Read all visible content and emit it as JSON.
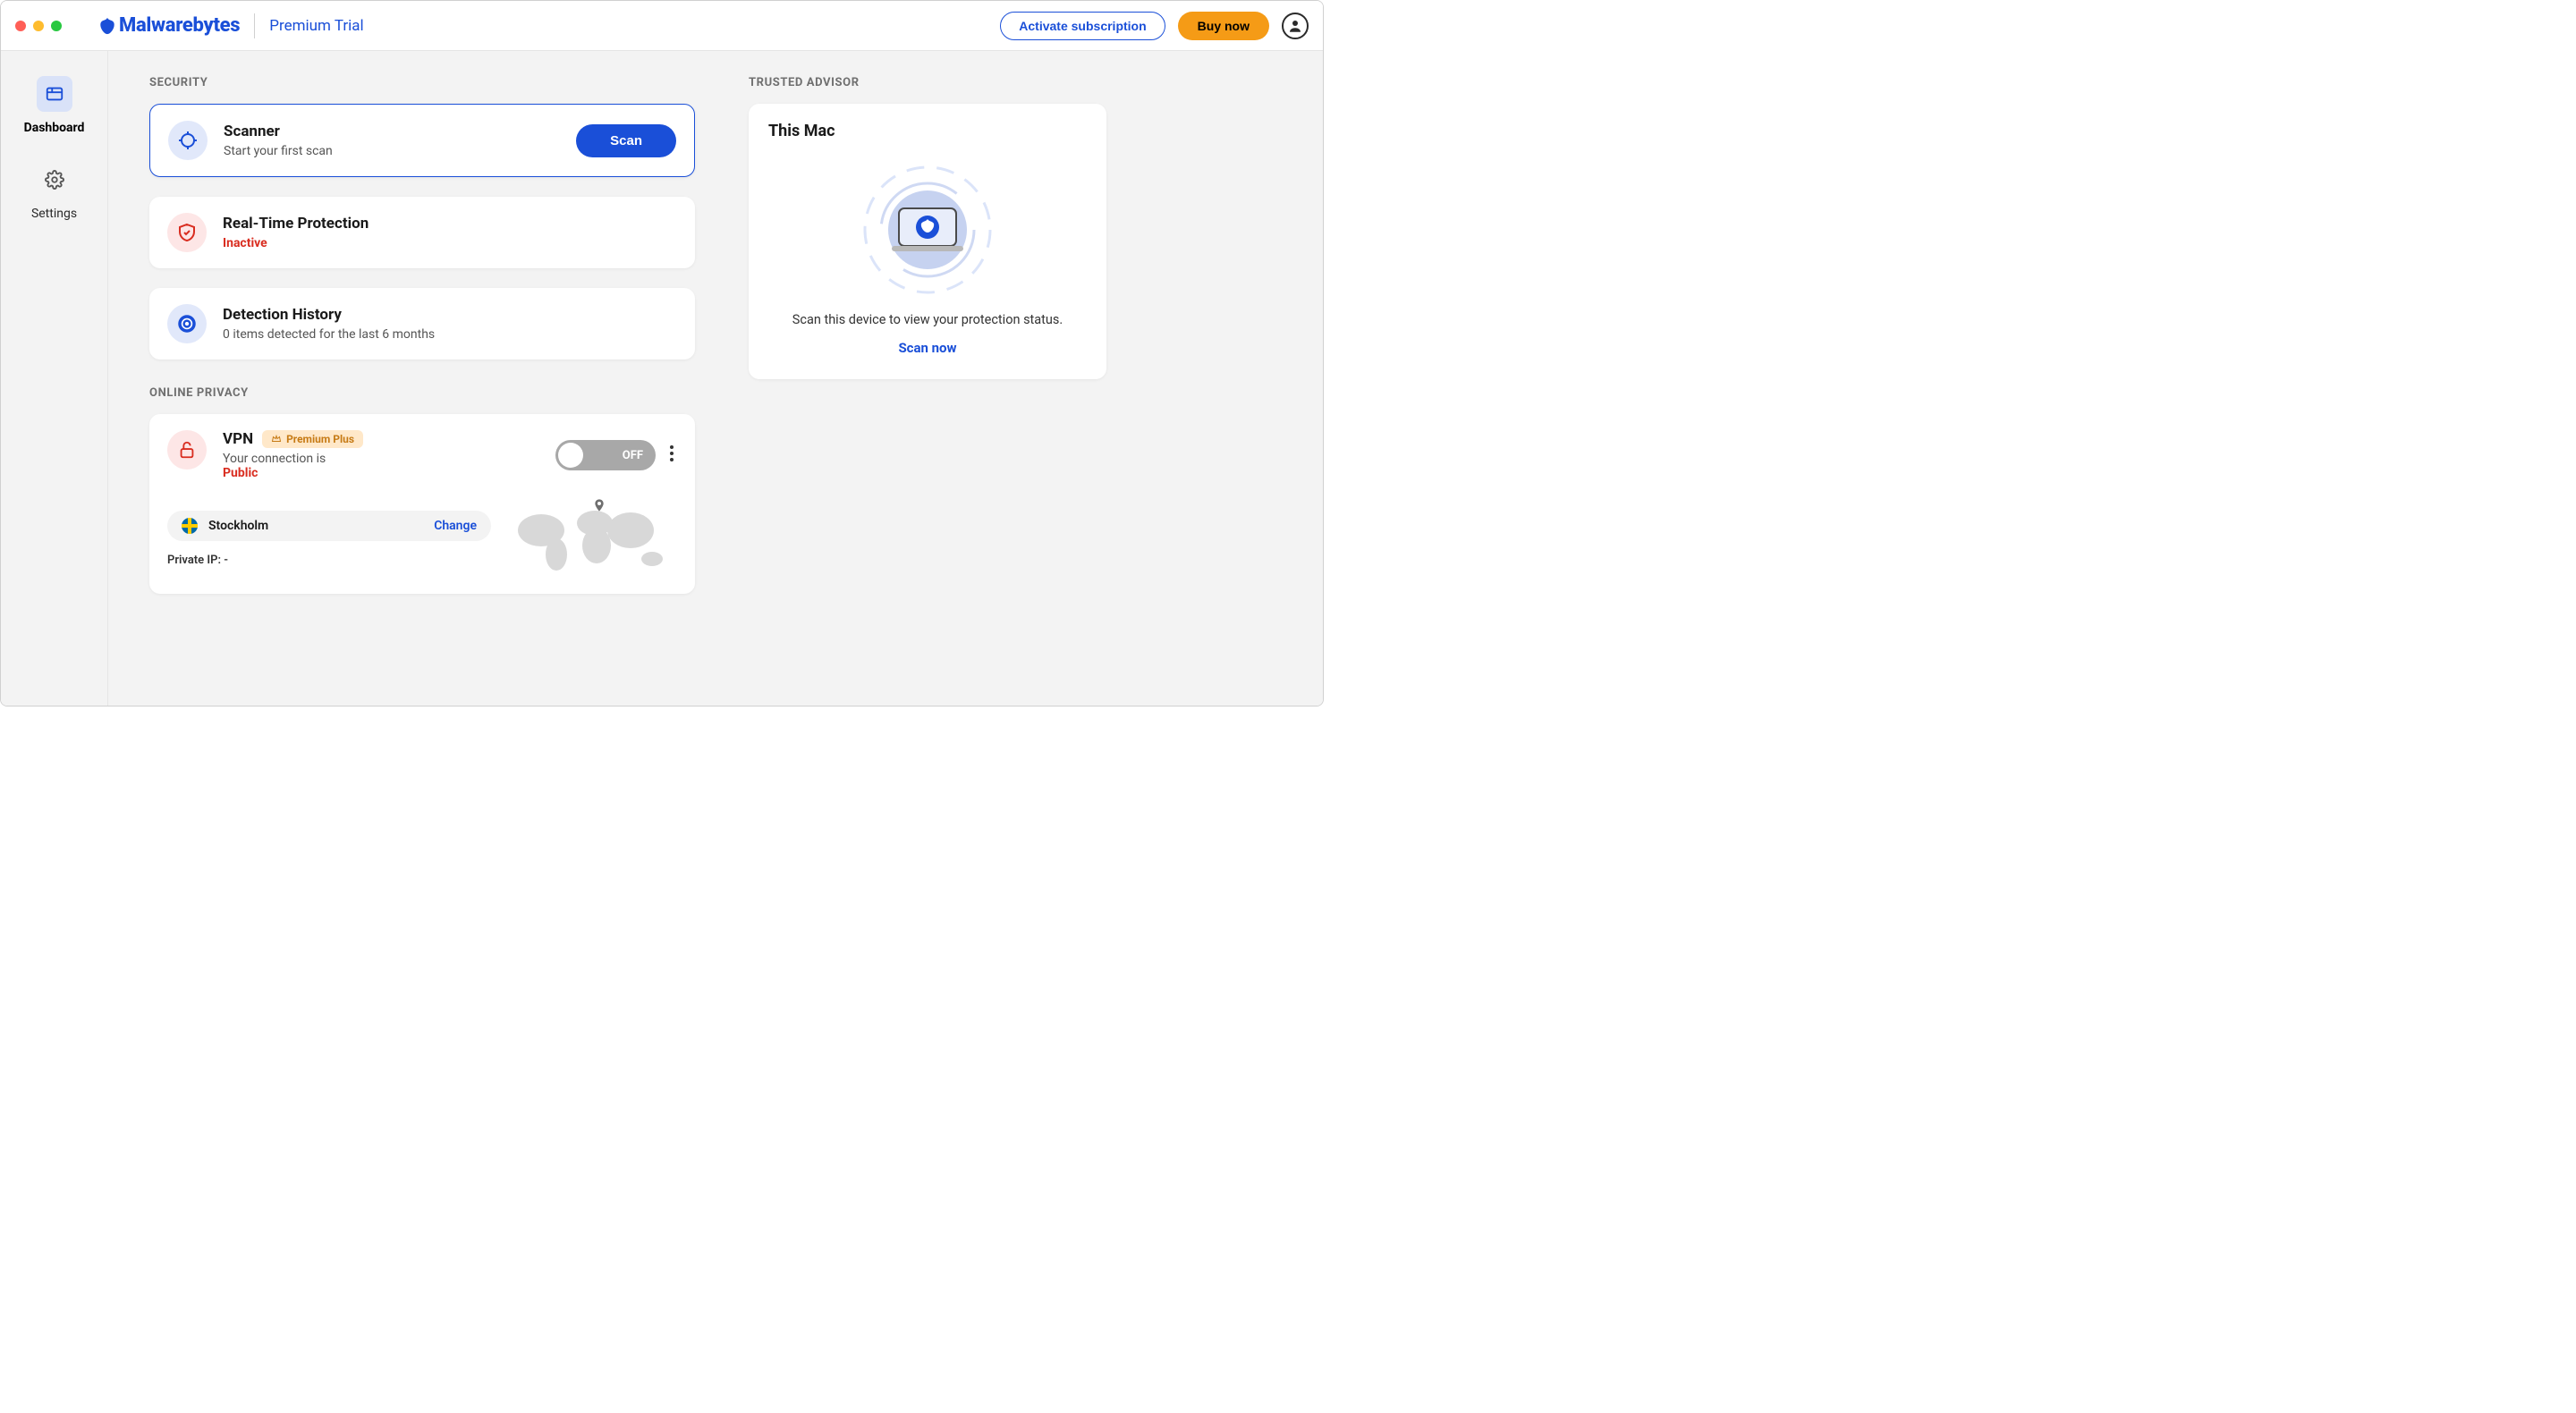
{
  "header": {
    "brand": "Malwarebytes",
    "trial": "Premium Trial",
    "activate": "Activate subscription",
    "buy": "Buy now"
  },
  "sidebar": {
    "items": [
      {
        "label": "Dashboard"
      },
      {
        "label": "Settings"
      }
    ]
  },
  "sections": {
    "security": "SECURITY",
    "privacy": "ONLINE PRIVACY",
    "advisor": "TRUSTED ADVISOR"
  },
  "scanner": {
    "title": "Scanner",
    "sub": "Start your first scan",
    "button": "Scan"
  },
  "rtp": {
    "title": "Real-Time Protection",
    "status": "Inactive"
  },
  "history": {
    "title": "Detection History",
    "sub": "0 items detected for the last 6 months"
  },
  "vpn": {
    "title": "VPN",
    "badge": "Premium Plus",
    "sub": "Your connection is",
    "status": "Public",
    "toggle": "OFF",
    "location": "Stockholm",
    "change": "Change",
    "ip_label": "Private IP: -"
  },
  "advisor": {
    "title": "This Mac",
    "msg": "Scan this device to view your protection status.",
    "action": "Scan now"
  }
}
